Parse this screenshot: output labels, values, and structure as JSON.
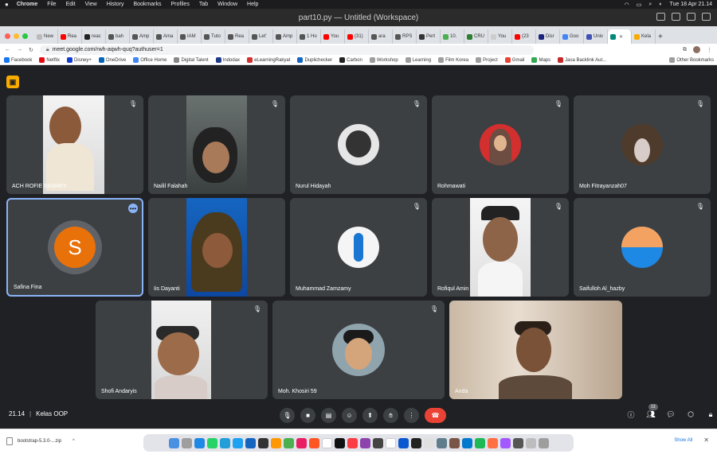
{
  "menubar": {
    "apple": "",
    "app": "Chrome",
    "items": [
      "File",
      "Edit",
      "View",
      "History",
      "Bookmarks",
      "Profiles",
      "Tab",
      "Window",
      "Help"
    ],
    "datetime": "Tue 18 Apr  21.14"
  },
  "vscode_title": "part10.py — Untitled (Workspace)",
  "tabs": [
    "New",
    "Rea",
    "reac",
    "bah",
    "Amp",
    "Ama",
    "IAM",
    "Tuto",
    "Rea",
    "Let'",
    "Amp",
    "1 Ho",
    "You",
    "(31)",
    "ara",
    "RPS",
    "Pert",
    "10.",
    "CRU",
    "You",
    "(23",
    "Disr",
    "Goo",
    "Univ",
    "",
    "Kela"
  ],
  "address": {
    "url": "meet.google.com/rwh-aqwh-quq?authuser=1"
  },
  "bookmarks": [
    "Facebook",
    "Netflix",
    "Disney+",
    "OneDrive",
    "Office Home",
    "Digital Talent",
    "Indodax",
    "eLearningRakyat",
    "Duplichecker",
    "Carbon",
    "Workshop",
    "Learning",
    "Film Korea",
    "Project",
    "Gmail",
    "Maps",
    "Jasa Backlink Aut...",
    "Other Bookmarks"
  ],
  "participants": [
    {
      "name": "ACH ROFIE BASHRY"
    },
    {
      "name": "Nailil Falahah"
    },
    {
      "name": "Nurul Hidayah"
    },
    {
      "name": "Rohmawati"
    },
    {
      "name": "Moh Fitrayanzah07"
    },
    {
      "name": "Safina Fina",
      "initial": "S"
    },
    {
      "name": "Iis Dayanti"
    },
    {
      "name": "Muhammad Zamzamy"
    },
    {
      "name": "Rofiqul Amin"
    },
    {
      "name": "Saifulloh Al_hazby"
    },
    {
      "name": "Shofi Andaryis"
    },
    {
      "name": "Moh. Khosiri 59"
    },
    {
      "name": "Anda"
    }
  ],
  "meeting": {
    "time": "21.14",
    "separator": "|",
    "title": "Kelas OOP",
    "participant_count": "13"
  },
  "download": {
    "filename": "bootstrap-5.3.0-...zip",
    "show_all": "Show All"
  }
}
